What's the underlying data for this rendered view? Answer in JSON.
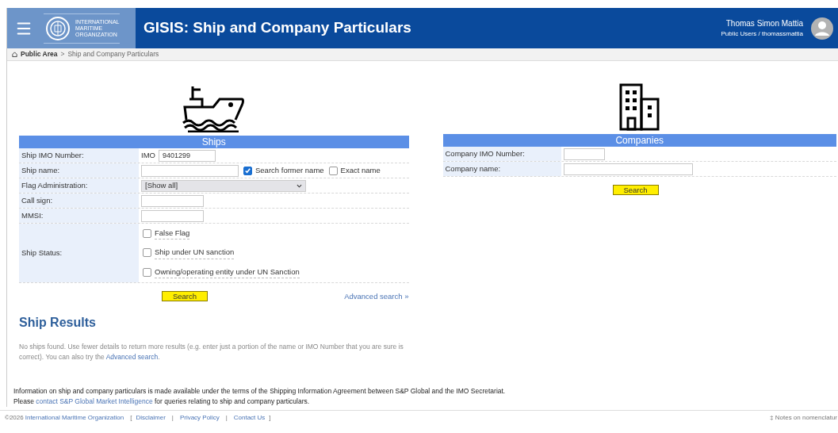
{
  "header": {
    "logo_lines": [
      "INTERNATIONAL",
      "MARITIME",
      "ORGANIZATION"
    ],
    "title": "GISIS: Ship and Company Particulars",
    "user_name": "Thomas Simon Mattia",
    "user_role": "Public Users / thomassmattia"
  },
  "breadcrumb": {
    "home": "Public Area",
    "separator": ">",
    "current": "Ship and Company Particulars"
  },
  "ships": {
    "title": "Ships",
    "fields": [
      {
        "kind": "imo",
        "label": "Ship IMO Number:",
        "prefix": "IMO",
        "value": "9401299"
      },
      {
        "kind": "name",
        "label": "Ship name:",
        "options": [
          {
            "label": "Search former name",
            "checked": true
          },
          {
            "label": "Exact name",
            "checked": false
          }
        ]
      },
      {
        "kind": "select",
        "label": "Flag Administration:",
        "value": "[Show all]"
      },
      {
        "kind": "text",
        "label": "Call sign:"
      },
      {
        "kind": "text",
        "label": "MMSI:"
      },
      {
        "kind": "checks",
        "label": "Ship Status:",
        "options": [
          {
            "label": "False Flag",
            "checked": false
          },
          {
            "label": "Ship under UN sanction",
            "checked": false
          },
          {
            "label": "Owning/operating entity under UN Sanction",
            "checked": false
          }
        ]
      }
    ],
    "search_button": "Search",
    "advanced_link": "Advanced search »"
  },
  "companies": {
    "title": "Companies",
    "fields": [
      {
        "kind": "short",
        "label": "Company IMO Number:"
      },
      {
        "kind": "long",
        "label": "Company name:"
      }
    ],
    "search_button": "Search"
  },
  "results": {
    "title": "Ship Results",
    "message": "No ships found. Use fewer details to return more results (e.g. enter just a portion of the name or IMO Number that you are sure is correct). You can also try the ",
    "link": "Advanced search",
    "end": "."
  },
  "info": {
    "line1": "Information on ship and company particulars is made available under the terms of the Shipping Information Agreement between S&P Global and the IMO Secretariat.",
    "line2_start": "Please ",
    "line2_link": "contact S&P Global Market Intelligence",
    "line2_end": " for queries relating to ship and company particulars."
  },
  "footer": {
    "copyright": "©2026",
    "org_link": "International Maritime Organization",
    "open": "[",
    "links": [
      "Disclaimer",
      "Privacy Policy",
      "Contact Us"
    ],
    "separator": "|",
    "close": "]",
    "notes": "‡ Notes on nomenclatur"
  }
}
